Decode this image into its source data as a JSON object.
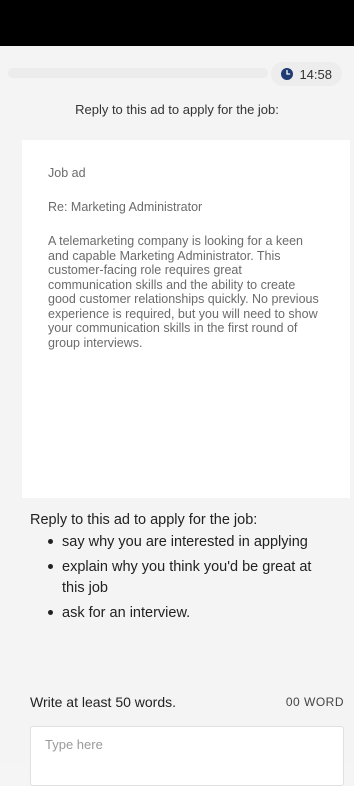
{
  "timer": {
    "time": "14:58",
    "progress": 0.0
  },
  "prompt_top": "Reply to this ad to apply for the job:",
  "ad": {
    "label": "Job ad",
    "subject": "Re: Marketing Administrator",
    "body": "A telemarketing company is looking for a keen and capable Marketing Administrator. This customer-facing role requires great communication skills and the ability to create good customer relationships quickly. No previous experience is required, but you will need to show your communication skills in the first round of group interviews."
  },
  "task": {
    "title": "Reply to this ad to apply for the job:",
    "bullets": [
      "say why you are interested in applying",
      "explain why you think you'd be great at this job",
      "ask for an interview."
    ]
  },
  "writing": {
    "instruction": "Write at least 50 words.",
    "word_count": "00 WORD",
    "placeholder": "Type here",
    "value": ""
  },
  "colors": {
    "clock_icon": "#1f3b73",
    "background": "#f4f4f4"
  }
}
